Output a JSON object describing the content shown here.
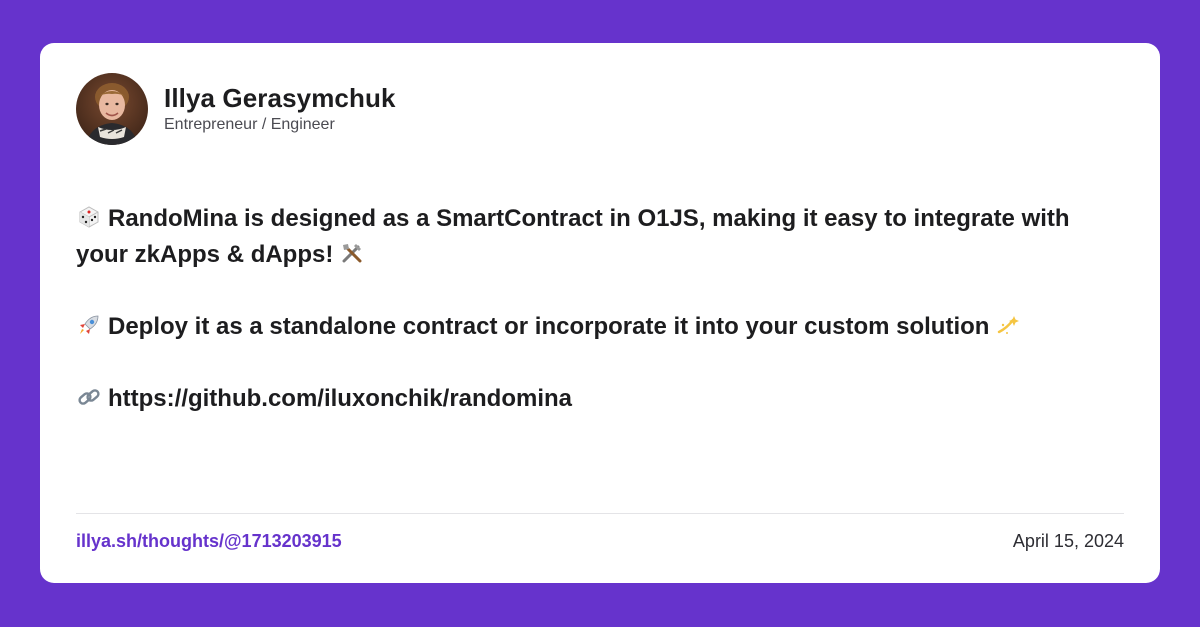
{
  "author": {
    "name": "Illya Gerasymchuk",
    "title": "Entrepreneur / Engineer"
  },
  "post": {
    "line1": "RandoMina is designed as a SmartContract in O1JS, making it easy to integrate with your zkApps & dApps!",
    "line2": "Deploy it as a standalone contract or incorporate it into your custom solution",
    "line3": "https://github.com/iluxonchik/randomina",
    "icons": [
      "die-icon",
      "tools-icon",
      "rocket-icon",
      "sparkle-icon",
      "link-icon"
    ]
  },
  "footer": {
    "link": "illya.sh/thoughts/@1713203915",
    "date": "April 15, 2024"
  },
  "colors": {
    "background": "#6633cc",
    "card": "#ffffff",
    "accent": "#6633cc"
  }
}
